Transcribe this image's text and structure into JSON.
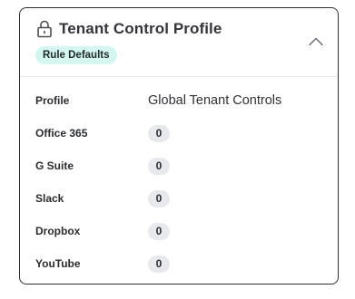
{
  "panel": {
    "title": "Tenant Control Profile",
    "badge": "Rule Defaults",
    "icons": {
      "header": "lock-icon",
      "collapse": "chevron-up-icon"
    },
    "colors": {
      "badge_bg": "#d5f5f1",
      "pill_bg": "#e8e9ec",
      "border": "#2b2d31"
    }
  },
  "rows": [
    {
      "label": "Profile",
      "value": "Global Tenant Controls"
    },
    {
      "label": "Office 365",
      "value": "0"
    },
    {
      "label": "G Suite",
      "value": "0"
    },
    {
      "label": "Slack",
      "value": "0"
    },
    {
      "label": "Dropbox",
      "value": "0"
    },
    {
      "label": "YouTube",
      "value": "0"
    }
  ]
}
